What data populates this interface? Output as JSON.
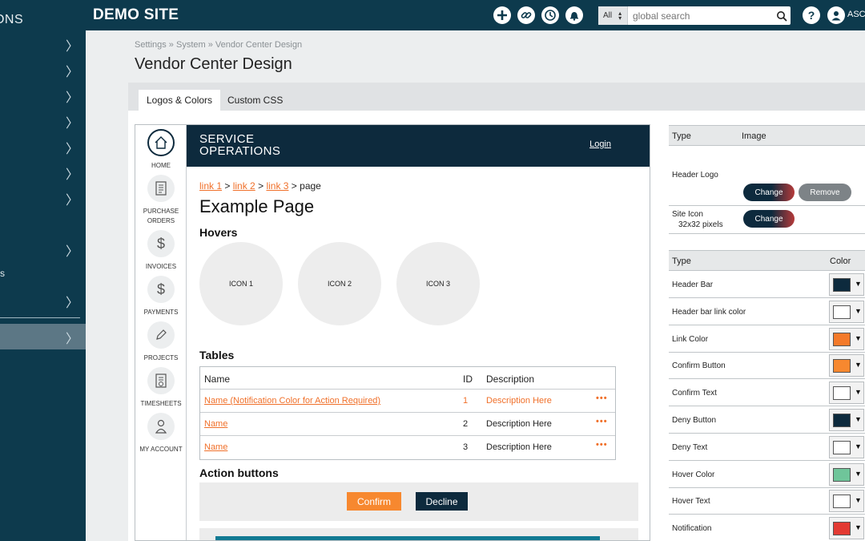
{
  "sidebar": {
    "title_fragment": "IONS",
    "items": [
      {
        "label": ""
      },
      {
        "label": ""
      },
      {
        "label": ""
      },
      {
        "label": ""
      },
      {
        "label": ""
      },
      {
        "label": ""
      },
      {
        "label": ""
      },
      {
        "label": ""
      },
      {
        "label": "s"
      },
      {
        "label": ""
      },
      {
        "label": ""
      }
    ],
    "chevron": "〉"
  },
  "topbar": {
    "site_title": "DEMO SITE",
    "search_scope": "All",
    "search_placeholder": "global search",
    "user_label": "ASC",
    "icons": [
      "plus-icon",
      "link-icon",
      "clock-icon",
      "bell-icon",
      "help-icon",
      "user-icon"
    ]
  },
  "breadcrumb": "Settings » System » Vendor Center Design",
  "page_title": "Vendor Center Design",
  "tabs": [
    {
      "label": "Logos & Colors",
      "active": true
    },
    {
      "label": "Custom CSS",
      "active": false
    }
  ],
  "preview": {
    "nav": [
      {
        "label": "HOME",
        "icon": "home-icon"
      },
      {
        "label": "PURCHASE ORDERS",
        "icon": "receipt-icon"
      },
      {
        "label": "INVOICES",
        "icon": "dollar-icon"
      },
      {
        "label": "PAYMENTS",
        "icon": "dollar-icon"
      },
      {
        "label": "PROJECTS",
        "icon": "pencil-icon"
      },
      {
        "label": "TIMESHEETS",
        "icon": "timesheet-icon"
      },
      {
        "label": "MY ACCOUNT",
        "icon": "person-icon"
      }
    ],
    "logo_line1": "SERVICE",
    "logo_line2": "OPERATIONS",
    "login": "Login",
    "crumb": {
      "link1": "link 1",
      "link2": "link 2",
      "link3": "link 3",
      "page": "page",
      "sep": ">"
    },
    "heading": "Example Page",
    "hovers_heading": "Hovers",
    "hover_icons": [
      "ICON 1",
      "ICON 2",
      "ICON 3"
    ],
    "tables_heading": "Tables",
    "table": {
      "headers": {
        "name": "Name",
        "id": "ID",
        "description": "Description"
      },
      "rows": [
        {
          "name": "Name (Notification Color for Action Required)",
          "id": "1",
          "description": "Description Here",
          "more": "•••",
          "alert": true
        },
        {
          "name": "Name",
          "id": "2",
          "description": "Description Here",
          "more": "•••",
          "alert": false
        },
        {
          "name": "Name",
          "id": "3",
          "description": "Description Here",
          "more": "•••",
          "alert": false
        }
      ]
    },
    "actions_heading": "Action buttons",
    "confirm": "Confirm",
    "decline": "Decline"
  },
  "images": {
    "header": {
      "type": "Type",
      "image": "Image"
    },
    "header_logo": "Header Logo",
    "change": "Change",
    "remove": "Remove",
    "site_icon": "Site Icon",
    "site_icon_size": "32x32 pixels"
  },
  "colors": {
    "header": {
      "type": "Type",
      "color": "Color"
    },
    "rows": [
      {
        "label": "Header Bar",
        "color": "#0d2a3d"
      },
      {
        "label": "Header bar link color",
        "color": "#ffffff"
      },
      {
        "label": "Link Color",
        "color": "#f47a2a"
      },
      {
        "label": "Confirm Button",
        "color": "#f7882f"
      },
      {
        "label": "Confirm Text",
        "color": "#ffffff"
      },
      {
        "label": "Deny Button",
        "color": "#0d2a3d"
      },
      {
        "label": "Deny Text",
        "color": "#ffffff"
      },
      {
        "label": "Hover Color",
        "color": "#6fc59a"
      },
      {
        "label": "Hover Text",
        "color": "#ffffff"
      },
      {
        "label": "Notification",
        "color": "#e33a33"
      }
    ],
    "arrow": "▼"
  }
}
